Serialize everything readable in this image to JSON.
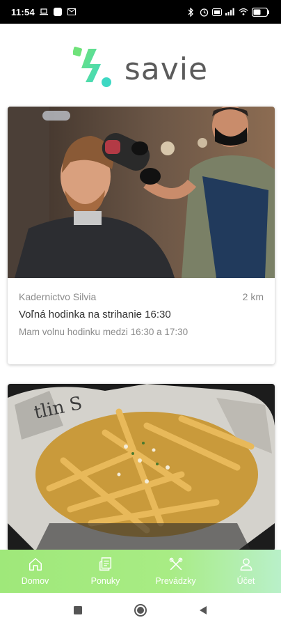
{
  "status_bar": {
    "time": "11:54",
    "battery": "55"
  },
  "header": {
    "brand": "savie",
    "colors": {
      "teal": "#3ed8c3",
      "green": "#6fe27a",
      "text": "#5b5b5b"
    }
  },
  "offers": [
    {
      "image_icon": "barber-photo",
      "shop": "Kadernictvo Silvia",
      "distance": "2 km",
      "title": "Voľná hodinka na strihanie 16:30",
      "description": "Mam volnu hodinku medzi 16:30 a 17:30"
    },
    {
      "image_icon": "fries-photo"
    }
  ],
  "bottom_nav": {
    "items": [
      {
        "label": "Domov",
        "icon": "home-icon"
      },
      {
        "label": "Ponuky",
        "icon": "receipt-icon"
      },
      {
        "label": "Prevádzky",
        "icon": "tools-icon"
      },
      {
        "label": "Účet",
        "icon": "user-icon"
      }
    ],
    "colors": {
      "background": "#a5ea80",
      "text": "#ffffff"
    }
  },
  "system_nav": {
    "icons": [
      "recents-icon",
      "home-circle-icon",
      "back-icon"
    ]
  }
}
